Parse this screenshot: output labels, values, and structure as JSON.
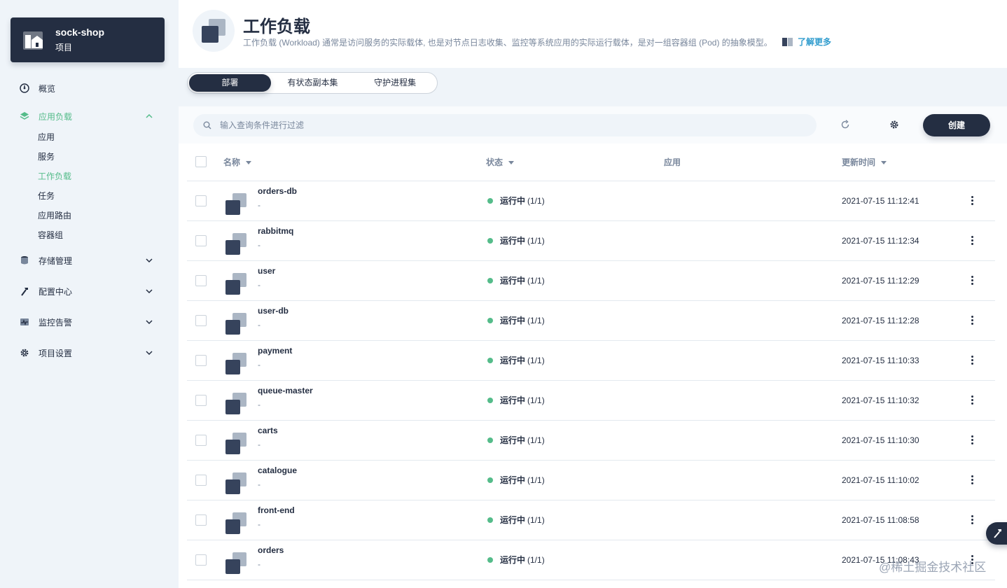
{
  "project": {
    "name": "sock-shop",
    "type": "项目"
  },
  "nav": {
    "overview": "概览",
    "app_workloads": "应用负载",
    "sub_items": [
      "应用",
      "服务",
      "工作负载",
      "任务",
      "应用路由",
      "容器组"
    ],
    "storage": "存储管理",
    "config": "配置中心",
    "monitoring": "监控告警",
    "settings": "项目设置"
  },
  "header": {
    "title": "工作负载",
    "description": "工作负载 (Workload) 通常是访问服务的实际载体, 也是对节点日志收集、监控等系统应用的实际运行载体，是对一组容器组 (Pod) 的抽象模型。",
    "learn_more": "了解更多"
  },
  "tabs": [
    "部署",
    "有状态副本集",
    "守护进程集"
  ],
  "toolbar": {
    "search_placeholder": "输入查询条件进行过滤",
    "create_label": "创建"
  },
  "table": {
    "headers": {
      "name": "名称",
      "status": "状态",
      "app": "应用",
      "updated": "更新时间"
    },
    "rows": [
      {
        "name": "orders-db",
        "desc": "-",
        "status": "运行中",
        "count": "(1/1)",
        "app": "",
        "updated": "2021-07-15 11:12:41"
      },
      {
        "name": "rabbitmq",
        "desc": "-",
        "status": "运行中",
        "count": "(1/1)",
        "app": "",
        "updated": "2021-07-15 11:12:34"
      },
      {
        "name": "user",
        "desc": "-",
        "status": "运行中",
        "count": "(1/1)",
        "app": "",
        "updated": "2021-07-15 11:12:29"
      },
      {
        "name": "user-db",
        "desc": "-",
        "status": "运行中",
        "count": "(1/1)",
        "app": "",
        "updated": "2021-07-15 11:12:28"
      },
      {
        "name": "payment",
        "desc": "-",
        "status": "运行中",
        "count": "(1/1)",
        "app": "",
        "updated": "2021-07-15 11:10:33"
      },
      {
        "name": "queue-master",
        "desc": "-",
        "status": "运行中",
        "count": "(1/1)",
        "app": "",
        "updated": "2021-07-15 11:10:32"
      },
      {
        "name": "carts",
        "desc": "-",
        "status": "运行中",
        "count": "(1/1)",
        "app": "",
        "updated": "2021-07-15 11:10:30"
      },
      {
        "name": "catalogue",
        "desc": "-",
        "status": "运行中",
        "count": "(1/1)",
        "app": "",
        "updated": "2021-07-15 11:10:02"
      },
      {
        "name": "front-end",
        "desc": "-",
        "status": "运行中",
        "count": "(1/1)",
        "app": "",
        "updated": "2021-07-15 11:08:58"
      },
      {
        "name": "orders",
        "desc": "-",
        "status": "运行中",
        "count": "(1/1)",
        "app": "",
        "updated": "2021-07-15 11:08:43"
      }
    ]
  },
  "watermark": "@稀土掘金技术社区",
  "colors": {
    "primary": "#242e42",
    "accent": "#55bc8a",
    "link": "#329dce",
    "muted": "#79879c",
    "bg": "#eff4f9"
  }
}
